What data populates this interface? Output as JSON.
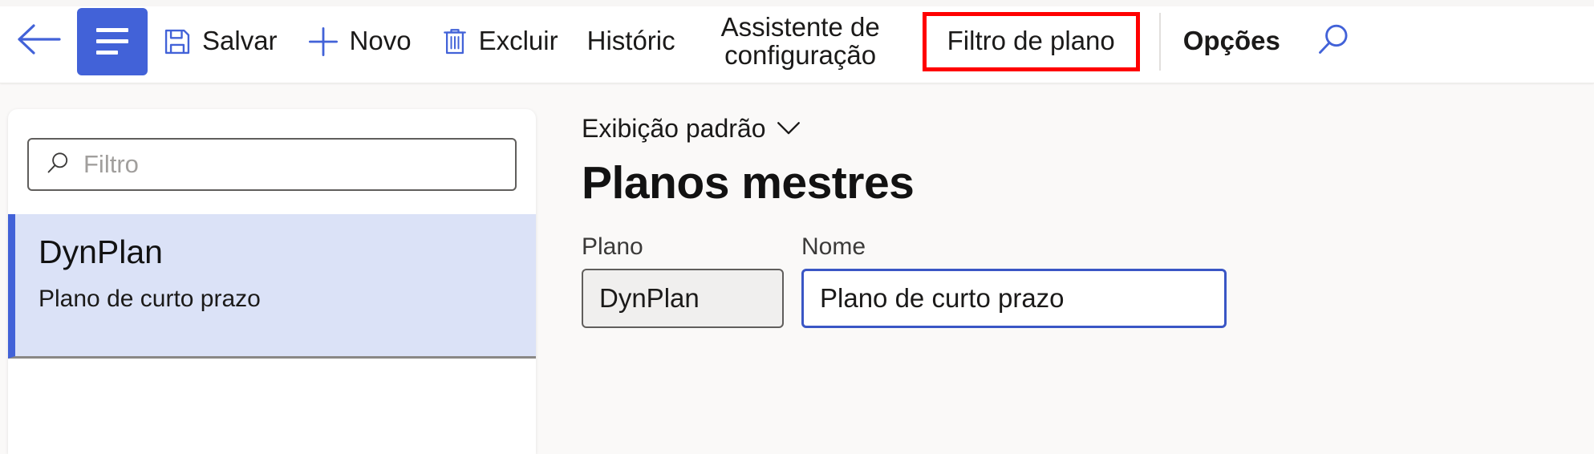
{
  "toolbar": {
    "back_icon": "arrow-left-icon",
    "nav_menu_icon": "hamburger-menu-icon",
    "commands": [
      {
        "id": "save",
        "label": "Salvar",
        "icon": "save-floppy-icon"
      },
      {
        "id": "new",
        "label": "Novo",
        "icon": "plus-icon"
      },
      {
        "id": "delete",
        "label": "Excluir",
        "icon": "trash-icon"
      },
      {
        "id": "history",
        "label": "Históric",
        "icon": "none"
      },
      {
        "id": "setup-wizard",
        "label": "Assistente de configuração",
        "icon": "none"
      },
      {
        "id": "plan-filter",
        "label": "Filtro de plano",
        "icon": "none"
      }
    ],
    "options_label": "Opções",
    "search_icon": "search-icon",
    "highlight_color": "#ff0000",
    "accent_color": "#4262d8"
  },
  "left_panel": {
    "filter": {
      "placeholder": "Filtro",
      "value": "",
      "icon": "search-icon"
    },
    "items": [
      {
        "title": "DynPlan",
        "subtitle": "Plano de curto prazo",
        "selected": true
      }
    ]
  },
  "content": {
    "view_selector": {
      "label": "Exibição padrão",
      "chevron": "chevron-down-icon"
    },
    "title": "Planos mestres",
    "fields": [
      {
        "id": "plano",
        "label": "Plano",
        "value": "DynPlan",
        "state": "readonly"
      },
      {
        "id": "nome",
        "label": "Nome",
        "value": "Plano de curto prazo",
        "state": "focused"
      }
    ]
  }
}
